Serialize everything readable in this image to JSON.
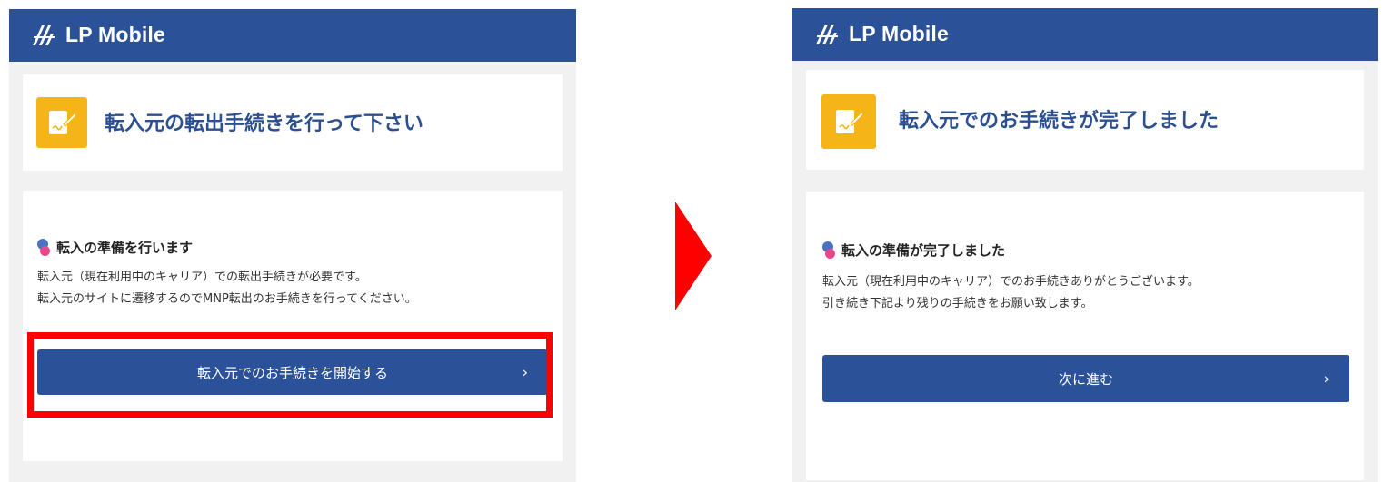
{
  "brand": {
    "name": "LP Mobile"
  },
  "colors": {
    "header": "#2b5198",
    "title": "#2b4f8f",
    "badge": "#f5b518",
    "accent_red": "#ff0000"
  },
  "screen_before": {
    "title": "転入元の転出手続きを行って下さい",
    "section_title": "転入の準備を行います",
    "lines": [
      "転入元（現在利用中のキャリア）での転出手続きが必要です。",
      "転入元のサイトに遷移するのでMNP転出のお手続きを行ってください。"
    ],
    "button_label": "転入元でのお手続きを開始する",
    "button_chevron": "›"
  },
  "screen_after": {
    "title": "転入元でのお手続きが完了しました",
    "section_title": "転入の準備が完了しました",
    "lines": [
      "転入元（現在利用中のキャリア）でのお手続きありがとうございます。",
      "引き続き下記より残りの手続きをお願い致します。"
    ],
    "button_label": "次に進む",
    "button_chevron": "›"
  }
}
